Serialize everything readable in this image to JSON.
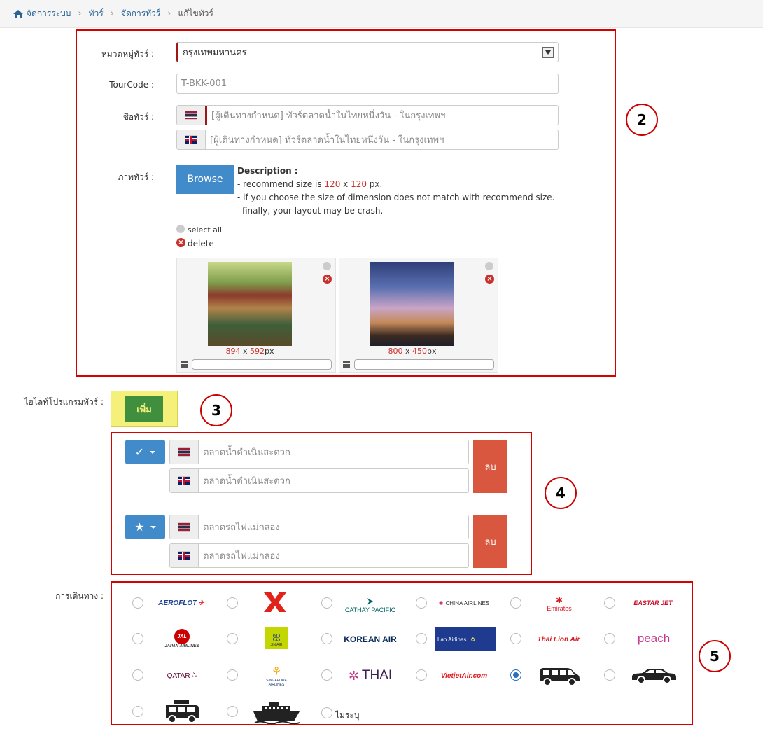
{
  "breadcrumb": {
    "home": "จัดการระบบ",
    "tours": "ทัวร์",
    "manage": "จัดการทัวร์",
    "current": "แก้ไขทัวร์",
    "sep": "›"
  },
  "form": {
    "category_label": "หมวดหมู่ทัวร์ :",
    "category_value": "กรุงเทพมหานคร",
    "tourcode_label": "TourCode :",
    "tourcode_value": "T-BKK-001",
    "name_label": "ชื่อทัวร์ :",
    "name_th": "[ผู้เดินทางกำหนด] ทัวร์ตลาดน้ำในไทยหนึ่งวัน - ในกรุงเทพฯ",
    "name_en": "[ผู้เดินทางกำหนด] ทัวร์ตลาดน้ำในไทยหนึ่งวัน - ในกรุงเทพฯ",
    "image_label": "ภาพทัวร์ :",
    "browse": "Browse",
    "desc_title": "Description :",
    "desc_line1_a": "- recommend size is ",
    "desc_w": "120",
    "desc_x": " x ",
    "desc_h": "120",
    "desc_line1_b": " px.",
    "desc_line2": "- if you choose the size of dimension does not match with recommend size.",
    "desc_line3": "finally, your layout may be crash.",
    "select_all": "select all",
    "delete": "delete",
    "images": [
      {
        "w": "894",
        "x": " x ",
        "h": "592",
        "unit": "px"
      },
      {
        "w": "800",
        "x": " x ",
        "h": "450",
        "unit": "px"
      }
    ]
  },
  "highlight": {
    "label": "ไฮไลท์โปรแกรมทัวร์ :",
    "add": "เพิ่ม",
    "items": [
      {
        "icon": "✓",
        "th": "ตลาดน้ำดำเนินสะดวก",
        "en": "ตลาดน้ำดำเนินสะดวก",
        "del": "ลบ"
      },
      {
        "icon": "★",
        "th": "ตลาดรถไฟแม่กลอง",
        "en": "ตลาดรถไฟแม่กลอง",
        "del": "ลบ"
      }
    ]
  },
  "travel": {
    "label": "การเดินทาง :",
    "logos": [
      "AEROFLOT",
      "AirAsia",
      "CATHAY PACIFIC",
      "CHINA AIRLINES",
      "Emirates",
      "EASTAR JET",
      "JAPAN AIRLINES",
      "JIN AIR",
      "KOREAN AIR",
      "Lao Airlines",
      "Thai Lion Air",
      "peach",
      "QATAR",
      "SINGAPORE AIRLINES",
      "THAI",
      "VietjetAir.com",
      "van",
      "car",
      "minibus",
      "ship"
    ],
    "none": "ไม่ระบุ",
    "selected": "van"
  },
  "annotations": [
    "2",
    "3",
    "4",
    "5"
  ],
  "colors": {
    "required": "#a01616",
    "primary": "#428bca",
    "delete": "#d9573e",
    "annotation": "#d50000",
    "add_bg": "#3f8f3f",
    "add_frame": "#f5f07a"
  }
}
